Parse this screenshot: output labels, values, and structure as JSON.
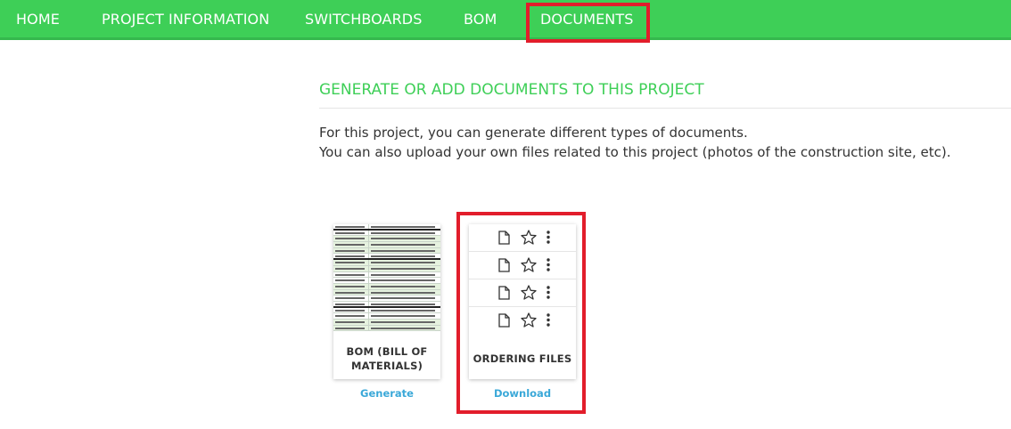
{
  "nav": {
    "items": [
      {
        "label": "HOME"
      },
      {
        "label": "PROJECT INFORMATION"
      },
      {
        "label": "SWITCHBOARDS"
      },
      {
        "label": "BOM"
      },
      {
        "label": "DOCUMENTS"
      }
    ],
    "active": "DOCUMENTS"
  },
  "main": {
    "title": "GENERATE OR ADD DOCUMENTS TO THIS PROJECT",
    "intro_line1": "For this project, you can generate different types of documents.",
    "intro_line2": "You can also upload your own files related to this project (photos of the construction site, etc)."
  },
  "cards": {
    "bom": {
      "label_line1": "BOM (BILL OF",
      "label_line2": "MATERIALS)",
      "action": "Generate"
    },
    "ordering": {
      "label": "ORDERING FILES",
      "action": "Download",
      "file_row_icons": [
        "file-icon",
        "star-icon",
        "more-vertical-icon"
      ]
    }
  },
  "colors": {
    "nav_bg": "#3ecf57",
    "accent_green": "#3ecf57",
    "link_blue": "#3aa8d8",
    "highlight_red": "#e21d2b"
  }
}
